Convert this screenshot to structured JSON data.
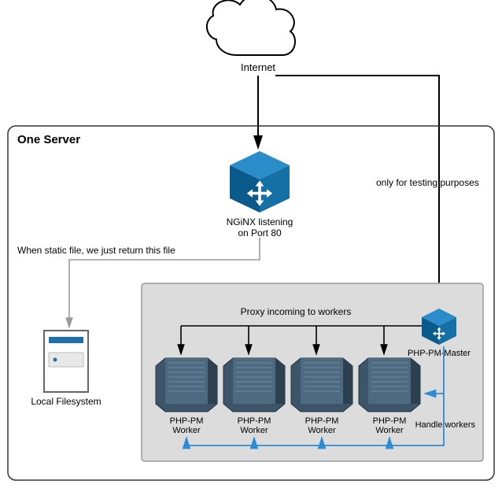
{
  "internet": {
    "label": "Internet"
  },
  "server": {
    "title": "One Server",
    "nginx_label_line1": "NGiNX listening",
    "nginx_label_line2": "on Port 80"
  },
  "labels": {
    "static_file": "When static file, we just return this file",
    "testing": "only for testing purposes",
    "proxy": "Proxy incoming to workers",
    "handle_workers": "Handle workers",
    "local_fs": "Local Filesystem",
    "php_pm_master": "PHP-PM-Master"
  },
  "workers": [
    {
      "label_line1": "PHP-PM",
      "label_line2": "Worker"
    },
    {
      "label_line1": "PHP-PM",
      "label_line2": "Worker"
    },
    {
      "label_line1": "PHP-PM",
      "label_line2": "Worker"
    },
    {
      "label_line1": "PHP-PM",
      "label_line2": "Worker"
    }
  ]
}
